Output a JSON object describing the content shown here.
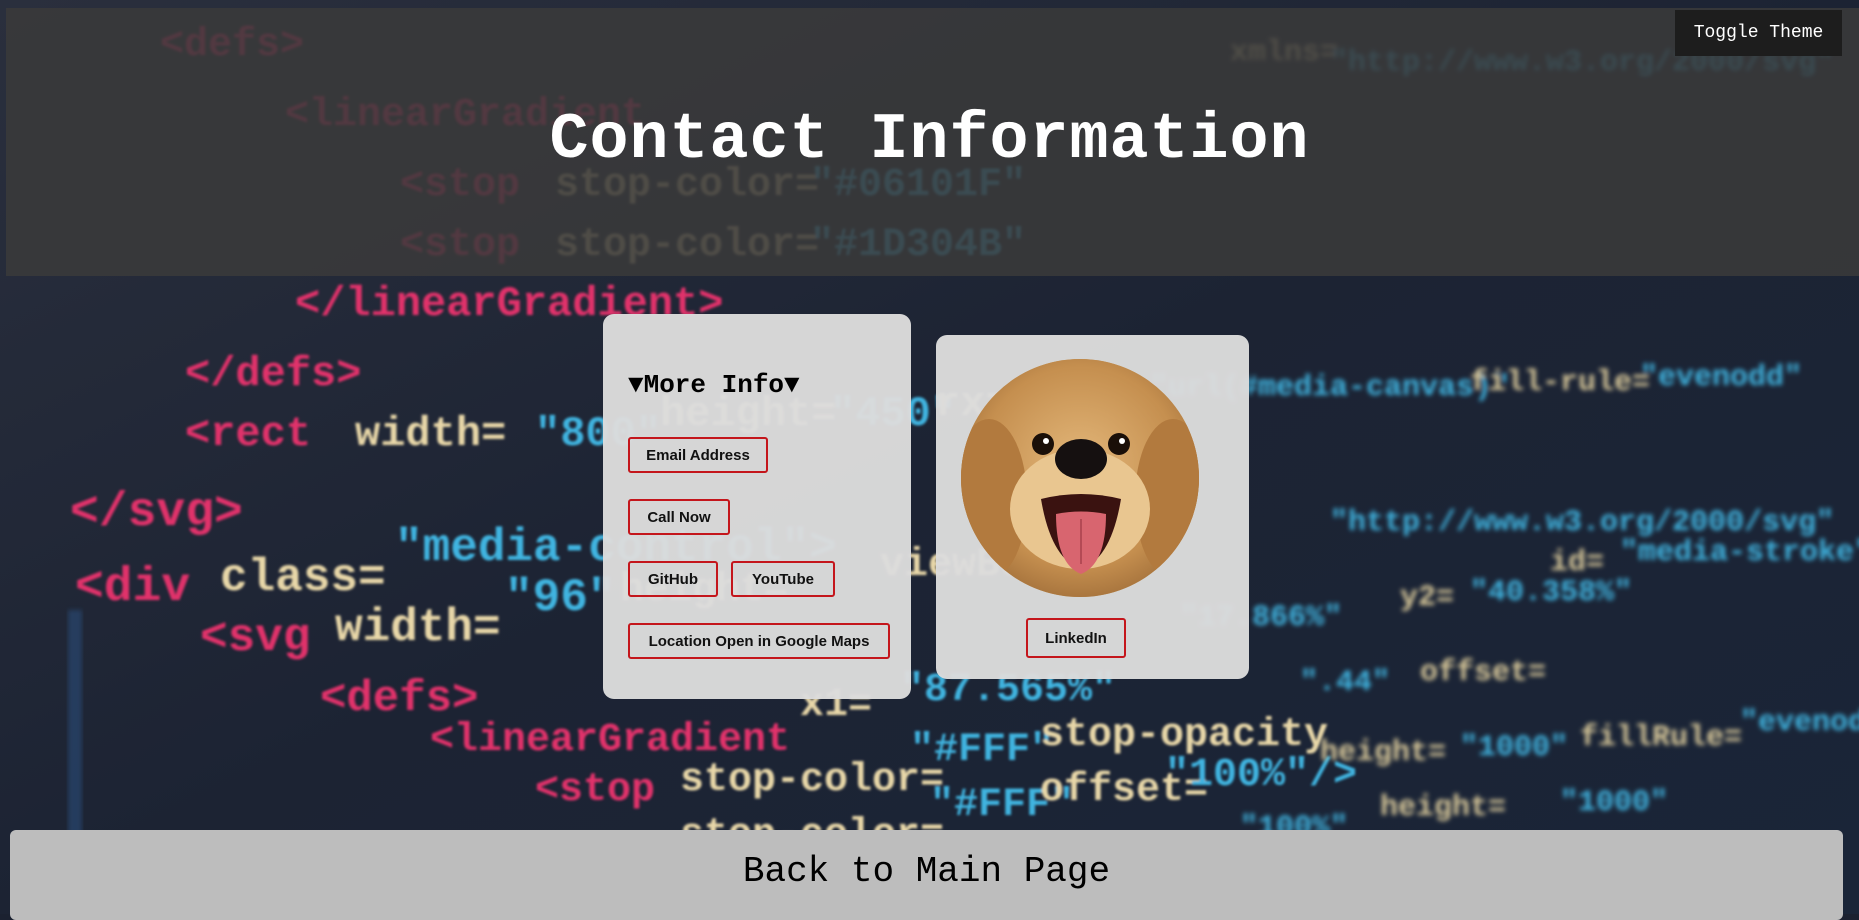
{
  "header": {
    "title": "Contact Information",
    "toggle_theme_label": "Toggle Theme"
  },
  "more_info": {
    "heading": "▼More Info▼",
    "buttons": {
      "email": "Email Address",
      "call": "Call Now",
      "github": "GitHub",
      "youtube": "YouTube",
      "location": "Location Open in Google Maps"
    }
  },
  "profile": {
    "linkedin_label": "LinkedIn"
  },
  "footer": {
    "back_label": "Back to Main Page"
  },
  "colors": {
    "accent_border": "#c4161c",
    "card_bg": "#dcdcdc",
    "header_bg": "#3a3a3a"
  }
}
